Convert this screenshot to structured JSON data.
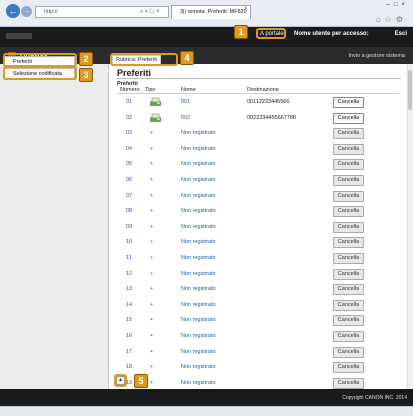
{
  "browser": {
    "address": "http://",
    "tab_title": "3|| remota: Preferiti: MF820"
  },
  "header": {
    "portal_link": "A portale",
    "login_label": "Nome utente per accesso:",
    "logout": "Esci",
    "mail_link": "Invio a gestore sistema",
    "section_title": "Rubrica"
  },
  "sidebar": {
    "items": [
      {
        "label": "Preferiti"
      },
      {
        "label": "Selezione codificata"
      }
    ]
  },
  "main": {
    "breadcrumb": "Rubrica: Preferiti",
    "title": "Preferiti",
    "section_title": "Preferiti",
    "columns": [
      "Numero",
      "Tipo",
      "Nome",
      "Destinazione"
    ],
    "delete_label": "Cancella",
    "rows": [
      {
        "num": "01",
        "type": "",
        "name": "001",
        "dest": "00112233445566"
      },
      {
        "num": "02",
        "type": "",
        "name": "002",
        "dest": "0022334455667788"
      },
      {
        "num": "03",
        "type": "+",
        "name": "Non registrato",
        "dest": ""
      },
      {
        "num": "04",
        "type": "+",
        "name": "Non registrato",
        "dest": ""
      },
      {
        "num": "05",
        "type": "+",
        "name": "Non registrato",
        "dest": ""
      },
      {
        "num": "06",
        "type": "+",
        "name": "Non registrato",
        "dest": ""
      },
      {
        "num": "07",
        "type": "+",
        "name": "Non registrato",
        "dest": ""
      },
      {
        "num": "08",
        "type": "+",
        "name": "Non registrato",
        "dest": ""
      },
      {
        "num": "09",
        "type": "+",
        "name": "Non registrato",
        "dest": ""
      },
      {
        "num": "10",
        "type": "+",
        "name": "Non registrato",
        "dest": ""
      },
      {
        "num": "11",
        "type": "+",
        "name": "Non registrato",
        "dest": ""
      },
      {
        "num": "12",
        "type": "+",
        "name": "Non registrato",
        "dest": ""
      },
      {
        "num": "13",
        "type": "+",
        "name": "Non registrato",
        "dest": ""
      },
      {
        "num": "14",
        "type": "+",
        "name": "Non registrato",
        "dest": ""
      },
      {
        "num": "15",
        "type": "+",
        "name": "Non registrato",
        "dest": ""
      },
      {
        "num": "16",
        "type": "+",
        "name": "Non registrato",
        "dest": ""
      },
      {
        "num": "17",
        "type": "+",
        "name": "Non registrato",
        "dest": ""
      },
      {
        "num": "18",
        "type": "+",
        "name": "Non registrato",
        "dest": ""
      },
      {
        "num": "19",
        "type": "+",
        "name": "Non registrato",
        "dest": ""
      }
    ]
  },
  "footer": {
    "copyright": "Copyright CANON INC. 2014"
  },
  "callouts": [
    "1",
    "2",
    "3",
    "4",
    "5"
  ],
  "colors": {
    "callout": "#e09a1a",
    "header_bg": "#1a1a1a",
    "link": "#225ba8"
  }
}
